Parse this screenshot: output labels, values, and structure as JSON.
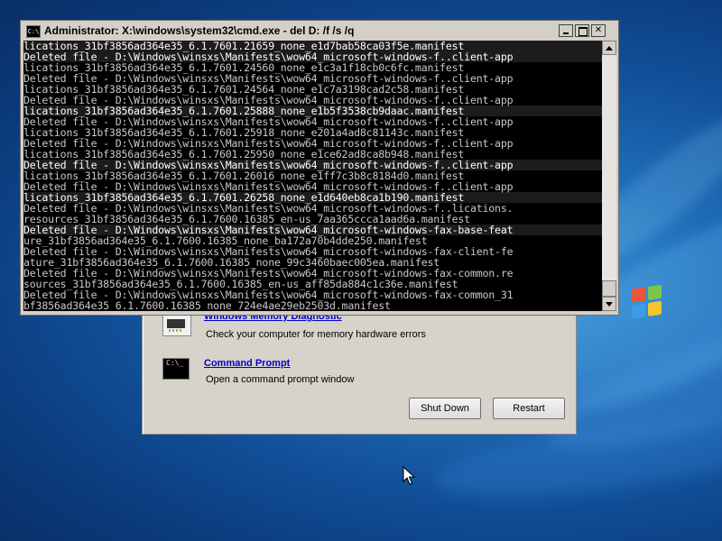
{
  "desktop": {
    "logo_colors": [
      "#e8573a",
      "#7cc64a",
      "#3e9be8",
      "#f4c531"
    ]
  },
  "recovery_dialog": {
    "tools": [
      {
        "title": "Windows Memory Diagnostic",
        "description": "Check your computer for memory hardware errors",
        "icon": "memory-chip-icon"
      },
      {
        "title": "Command Prompt",
        "description": "Open a command prompt window",
        "icon": "command-prompt-icon"
      }
    ],
    "buttons": {
      "shut_down": "Shut Down",
      "restart": "Restart"
    }
  },
  "console": {
    "title": "Administrator: X:\\windows\\system32\\cmd.exe - del  D: /f /s /q",
    "title_icon_text": "C:\\",
    "window_buttons": [
      "minimize",
      "maximize",
      "close"
    ],
    "lines": [
      "lications_31bf3856ad364e35_6.1.7601.21659_none_e1d7bab58ca03f5e.manifest",
      "Deleted file - D:\\Windows\\winsxs\\Manifests\\wow64_microsoft-windows-f..client-app",
      "lications_31bf3856ad364e35_6.1.7601.24560_none_e1c3a1f18cb0c6fc.manifest",
      "Deleted file - D:\\Windows\\winsxs\\Manifests\\wow64_microsoft-windows-f..client-app",
      "lications_31bf3856ad364e35_6.1.7601.24564_none_e1c7a3198cad2c58.manifest",
      "Deleted file - D:\\Windows\\winsxs\\Manifests\\wow64_microsoft-windows-f..client-app",
      "lications_31bf3856ad364e35_6.1.7601.25888_none_e1b5f3538cb9daac.manifest",
      "Deleted file - D:\\Windows\\winsxs\\Manifests\\wow64_microsoft-windows-f..client-app",
      "lications_31bf3856ad364e35_6.1.7601.25918_none_e201a4ad8c81143c.manifest",
      "Deleted file - D:\\Windows\\winsxs\\Manifests\\wow64_microsoft-windows-f..client-app",
      "lications_31bf3856ad364e35_6.1.7601.25950_none_e1ce62ad8ca8b948.manifest",
      "Deleted file - D:\\Windows\\winsxs\\Manifests\\wow64_microsoft-windows-f..client-app",
      "lications_31bf3856ad364e35_6.1.7601.26016_none_e1ff7c3b8c8184d0.manifest",
      "Deleted file - D:\\Windows\\winsxs\\Manifests\\wow64_microsoft-windows-f..client-app",
      "lications_31bf3856ad364e35_6.1.7601.26258_none_e1d640eb8ca1b190.manifest",
      "Deleted file - D:\\Windows\\winsxs\\Manifests\\wow64_microsoft-windows-f..lications.",
      "resources_31bf3856ad364e35_6.1.7600.16385_en-us_7aa365ccca1aad6a.manifest",
      "Deleted file - D:\\Windows\\winsxs\\Manifests\\wow64_microsoft-windows-fax-base-feat",
      "ure_31bf3856ad364e35_6.1.7600.16385_none_ba172a70b4dde250.manifest",
      "Deleted file - D:\\Windows\\winsxs\\Manifests\\wow64_microsoft-windows-fax-client-fe",
      "ature_31bf3856ad364e35_6.1.7600.16385_none_99c3460baec005ea.manifest",
      "Deleted file - D:\\Windows\\winsxs\\Manifests\\wow64_microsoft-windows-fax-common.re",
      "sources_31bf3856ad364e35_6.1.7600.16385_en-us_aff85da884c1c36e.manifest",
      "Deleted file - D:\\Windows\\winsxs\\Manifests\\wow64_microsoft-windows-fax-common_31",
      "bf3856ad364e35_6.1.7600.16385_none_724e4ae29eb2503d.manifest"
    ],
    "highlighted_lines": [
      0,
      1,
      6,
      11,
      14,
      17
    ]
  }
}
